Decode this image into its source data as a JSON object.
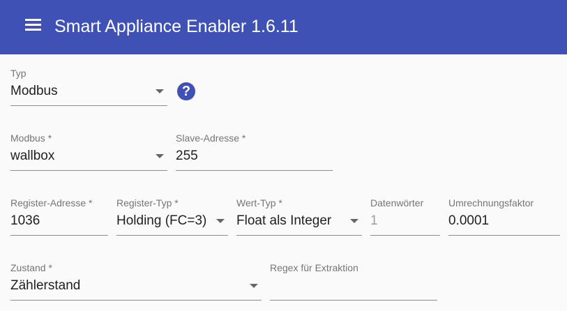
{
  "header": {
    "menu_icon": "menu-icon",
    "title": "Smart Appliance Enabler 1.6.11",
    "background_color": "#3f51b5"
  },
  "form": {
    "typ": {
      "label": "Typ",
      "value": "Modbus",
      "help_icon": "help-icon",
      "help_glyph": "?"
    },
    "modbus": {
      "label": "Modbus *",
      "value": "wallbox"
    },
    "slave_address": {
      "label": "Slave-Adresse *",
      "value": "255"
    },
    "register_address": {
      "label": "Register-Adresse *",
      "value": "1036"
    },
    "register_type": {
      "label": "Register-Typ *",
      "value": "Holding (FC=3)"
    },
    "value_type": {
      "label": "Wert-Typ *",
      "value": "Float als Integer"
    },
    "data_words": {
      "label": "Datenwörter",
      "value": "1"
    },
    "conversion_factor": {
      "label": "Umrechnungsfaktor",
      "value": "0.0001"
    },
    "state": {
      "label": "Zustand *",
      "value": "Zählerstand"
    },
    "regex": {
      "label": "Regex für Extraktion",
      "value": ""
    }
  }
}
